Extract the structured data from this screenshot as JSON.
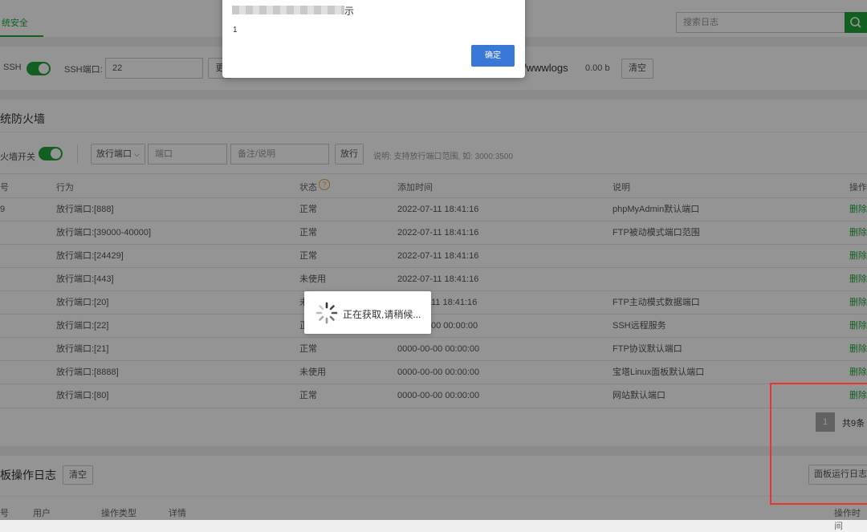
{
  "topbar": {
    "tab_label": "统安全",
    "search_placeholder": "搜索日志"
  },
  "ssh_panel": {
    "ssh_label": "SSH",
    "port_label": "SSH端口:",
    "port_value": "22",
    "change_button_partial": "更",
    "log_path_partial": "/wwwlogs",
    "log_size": "0.00 b",
    "clear_button": "清空"
  },
  "firewall": {
    "title": "统防火墙",
    "switch_label": "火墙开关",
    "select_value": "放行端口",
    "port_placeholder": "端口",
    "remark_placeholder": "备注/说明",
    "submit_button": "放行",
    "hint": "说明: 支持放行端口范围, 如: 3000:3500",
    "headers": {
      "id": "号",
      "action": "行为",
      "status": "状态",
      "help_icon": "?",
      "time": "添加时间",
      "desc": "说明",
      "op": "操作"
    },
    "rows": [
      {
        "id": "9",
        "action": "放行端口:[888]",
        "status": "正常",
        "time": "2022-07-11 18:41:16",
        "desc": "phpMyAdmin默认端口",
        "op": "删除"
      },
      {
        "id": "",
        "action": "放行端口:[39000-40000]",
        "status": "正常",
        "time": "2022-07-11 18:41:16",
        "desc": "FTP被动模式端口范围",
        "op": "删除"
      },
      {
        "id": "",
        "action": "放行端口:[24429]",
        "status": "正常",
        "time": "2022-07-11 18:41:16",
        "desc": "",
        "op": "删除"
      },
      {
        "id": "",
        "action": "放行端口:[443]",
        "status": "未使用",
        "time": "2022-07-11 18:41:16",
        "desc": "",
        "op": "删除"
      },
      {
        "id": "",
        "action": "放行端口:[20]",
        "status": "未",
        "time": "11 18:41:16",
        "desc": "FTP主动模式数据端口",
        "op": "删除"
      },
      {
        "id": "",
        "action": "放行端口:[22]",
        "status": "正",
        "time": "00 00:00:00",
        "desc": "SSH远程服务",
        "op": "删除"
      },
      {
        "id": "",
        "action": "放行端口:[21]",
        "status": "正常",
        "time": "0000-00-00 00:00:00",
        "desc": "FTP协议默认端口",
        "op": "删除"
      },
      {
        "id": "",
        "action": "放行端口:[8888]",
        "status": "未使用",
        "time": "0000-00-00 00:00:00",
        "desc": "宝塔Linux面板默认端口",
        "op": "删除"
      },
      {
        "id": "",
        "action": "放行端口:[80]",
        "status": "正常",
        "time": "0000-00-00 00:00:00",
        "desc": "网站默认端口",
        "op": "删除"
      }
    ],
    "pagination": {
      "current_page": "1",
      "total": "共9条"
    }
  },
  "panel_log": {
    "title": "板操作日志",
    "clear_button": "清空",
    "run_log_button": "面板运行日志",
    "headers": {
      "id": "号",
      "user": "用户",
      "type": "操作类型",
      "detail": "详情",
      "time": "操作时间"
    }
  },
  "dialog": {
    "title_suffix": "示",
    "message": "1",
    "confirm_button": "确定"
  },
  "loading": {
    "text": "正在获取,请稍候..."
  },
  "colors": {
    "accent": "#20a53a",
    "dialog_button": "#3a78d8",
    "highlight_border": "#e8352e"
  }
}
